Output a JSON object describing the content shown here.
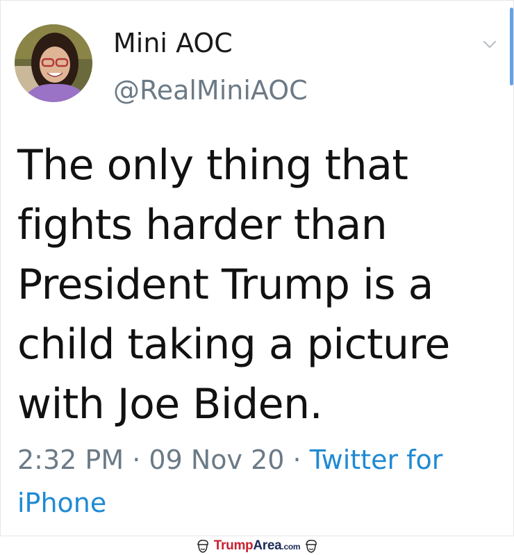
{
  "tweet": {
    "display_name": "Mini AOC",
    "handle": "@RealMiniAOC",
    "text_lines": [
      "The only thing that",
      "fights harder than",
      "President Trump is a",
      "child taking a picture",
      "with Joe Biden."
    ],
    "time": "2:32 PM",
    "separator": "·",
    "date": "09 Nov 20",
    "source": "Twitter for iPhone"
  },
  "footer": {
    "brand_trump": "Trump",
    "brand_area": "Area",
    "brand_com": ".com"
  },
  "icons": {
    "menu": "chevron-down-icon",
    "avatar": "avatar",
    "footer_left": "trump-face-icon",
    "footer_right": "trump-face-icon"
  },
  "colors": {
    "text": "#111111",
    "muted": "#6b7a86",
    "link": "#1f8ad3",
    "brand_red": "#c8202f",
    "brand_navy": "#1c2a5a"
  }
}
